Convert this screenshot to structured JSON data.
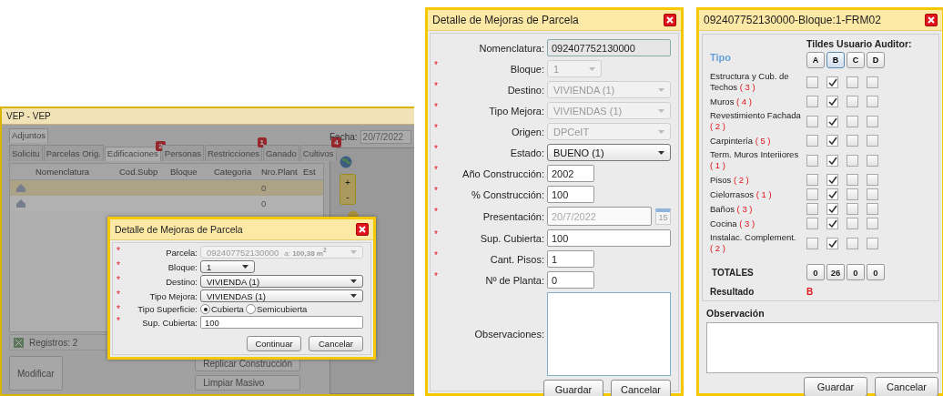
{
  "background_app": {
    "title": "VEP - VEP",
    "top_tabs": [
      {
        "label": "Adjuntos",
        "selected": true
      }
    ],
    "tabs": [
      {
        "label": "Solicitu",
        "selected": false
      },
      {
        "label": "Parcelas Orig.",
        "selected": false
      },
      {
        "label": "Edificaciones",
        "badge": "2",
        "selected": true
      },
      {
        "label": "Personas",
        "selected": false
      },
      {
        "label": "Restricciones",
        "badge": "1",
        "selected": false
      },
      {
        "label": "Ganado",
        "selected": false
      },
      {
        "label": "Cultivos",
        "badge": "4",
        "selected": false
      }
    ],
    "date_label": "Fecha:",
    "date_value": "20/7/2022",
    "table": {
      "columns": [
        "Nomenclatura",
        "Cod.Subp",
        "Bloque",
        "Categoria",
        "Nro.Plant",
        "Est"
      ],
      "rows": [
        {
          "selected": true,
          "nro_plant": "0"
        },
        {
          "selected": false,
          "nro_plant": "0"
        }
      ]
    },
    "records": "Registros: 2",
    "buttons": [
      "Modificar",
      "Replicar Construcción",
      "Limpiar Masivo"
    ],
    "map": {
      "zoom_in": "+",
      "zoom_out": "-"
    }
  },
  "parcel_dialog": {
    "title": "Detalle de Mejoras de Parcela",
    "required_mark": "*",
    "fields": [
      {
        "label": "Parcela:",
        "kind": "select",
        "required": true,
        "disabled": true,
        "value": "092407752130000",
        "note": "a: **100,38 m$^{2}$**"
      },
      {
        "label": "Bloque:",
        "kind": "short_select",
        "required": true,
        "disabled": false,
        "value": "1"
      },
      {
        "label": "Destino:",
        "kind": "select",
        "required": true,
        "disabled": false,
        "value": "VIVIENDA (1)"
      },
      {
        "label": "Tipo Mejora:",
        "kind": "select",
        "required": true,
        "disabled": false,
        "value": "VIVIENDAS (1)"
      },
      {
        "label": "Tipo Superficie:",
        "kind": "radio",
        "required": true,
        "disabled": false,
        "options": [
          {
            "label": "Cubierta",
            "selected": true
          },
          {
            "label": "Semicubierta",
            "selected": false
          }
        ]
      },
      {
        "label": "Sup. Cubierta:",
        "kind": "text",
        "required": true,
        "disabled": false,
        "value": "100"
      }
    ],
    "buttons": [
      "Continuar",
      "Cancelar"
    ]
  },
  "detail_dialog": {
    "title": "Detalle de Mejoras de Parcela",
    "required_mark": "*",
    "fields": [
      {
        "label": "Nomenclatura:",
        "kind": "readonly",
        "required": false,
        "disabled": false,
        "value": "092407752130000"
      },
      {
        "label": "Bloque:",
        "kind": "short_select",
        "required": true,
        "disabled": true,
        "value": "1"
      },
      {
        "label": "Destino:",
        "kind": "select",
        "required": true,
        "disabled": true,
        "value": "VIVIENDA (1)"
      },
      {
        "label": "Tipo Mejora:",
        "kind": "select",
        "required": true,
        "disabled": true,
        "value": "VIVIENDAS (1)"
      },
      {
        "label": "Origen:",
        "kind": "select",
        "required": true,
        "disabled": true,
        "value": "DPCeIT"
      },
      {
        "label": "Estado:",
        "kind": "select",
        "required": true,
        "disabled": false,
        "value": "BUENO (1)"
      },
      {
        "label": "Año Construcción:",
        "kind": "short_text",
        "required": true,
        "disabled": false,
        "value": "2002"
      },
      {
        "label": "% Construcción:",
        "kind": "short_text",
        "required": true,
        "disabled": false,
        "value": "100"
      },
      {
        "label": "Presentación:",
        "kind": "date",
        "required": true,
        "disabled": true,
        "value": "20/7/2022",
        "calendar_label": "15"
      },
      {
        "label": "Sup. Cubierta:",
        "kind": "text",
        "required": true,
        "disabled": false,
        "value": "100"
      },
      {
        "label": "Cant. Pisos:",
        "kind": "short_text",
        "required": true,
        "disabled": false,
        "value": "1"
      },
      {
        "label": "Nº de Planta:",
        "kind": "short_text",
        "required": true,
        "disabled": false,
        "value": "0"
      },
      {
        "label": "Observaciones:",
        "kind": "textarea",
        "required": false,
        "disabled": false
      }
    ],
    "buttons": [
      "Guardar",
      "Cancelar"
    ]
  },
  "audit_dialog": {
    "title": "092407752130000-Bloque:1-FRM02",
    "type_heading": "Tipo",
    "auditor_heading": "Tildes Usuario Auditor:",
    "columns": [
      {
        "label": "A",
        "selected": false
      },
      {
        "label": "B",
        "selected": true
      },
      {
        "label": "C",
        "selected": false
      },
      {
        "label": "D",
        "selected": false
      }
    ],
    "rows": [
      {
        "label": "Estructura y Cub. de Techos",
        "points": "( 3 )",
        "checks": [
          {
            "checked": false
          },
          {
            "checked": true
          },
          {
            "checked": false
          },
          {
            "checked": false
          }
        ]
      },
      {
        "label": "Muros",
        "points": "( 4 )",
        "checks": [
          {
            "checked": false
          },
          {
            "checked": true
          },
          {
            "checked": false
          },
          {
            "checked": false
          }
        ]
      },
      {
        "label": "Revestimiento Fachada",
        "points": "( 2 )",
        "checks": [
          {
            "checked": false
          },
          {
            "checked": true
          },
          {
            "checked": false
          },
          {
            "checked": false
          }
        ]
      },
      {
        "label": "Carpintería",
        "points": "( 5 )",
        "checks": [
          {
            "checked": false
          },
          {
            "checked": true
          },
          {
            "checked": false
          },
          {
            "checked": false
          }
        ]
      },
      {
        "label": "Term. Muros Interiiores",
        "points": "( 1 )",
        "checks": [
          {
            "checked": false
          },
          {
            "checked": true
          },
          {
            "checked": false
          },
          {
            "checked": false
          }
        ]
      },
      {
        "label": "Pisos",
        "points": "( 2 )",
        "checks": [
          {
            "checked": false
          },
          {
            "checked": true
          },
          {
            "checked": false
          },
          {
            "checked": false
          }
        ]
      },
      {
        "label": "Cielorrasos",
        "points": "( 1 )",
        "checks": [
          {
            "checked": false
          },
          {
            "checked": true
          },
          {
            "checked": false
          },
          {
            "checked": false
          }
        ]
      },
      {
        "label": "Baños",
        "points": "( 3 )",
        "checks": [
          {
            "checked": false
          },
          {
            "checked": true
          },
          {
            "checked": false
          },
          {
            "checked": false
          }
        ]
      },
      {
        "label": "Cocina",
        "points": "( 3 )",
        "checks": [
          {
            "checked": false
          },
          {
            "checked": true
          },
          {
            "checked": false
          },
          {
            "checked": false
          }
        ]
      },
      {
        "label": "Instalac. Complement.",
        "points": "( 2 )",
        "checks": [
          {
            "checked": false
          },
          {
            "checked": true
          },
          {
            "checked": false
          },
          {
            "checked": false
          }
        ]
      }
    ],
    "totals_label": "TOTALES",
    "totals": [
      "0",
      "26",
      "0",
      "0"
    ],
    "result_label": "Resultado",
    "result": "B",
    "observation_label": "Observación",
    "buttons": [
      "Guardar",
      "Cancelar"
    ]
  }
}
